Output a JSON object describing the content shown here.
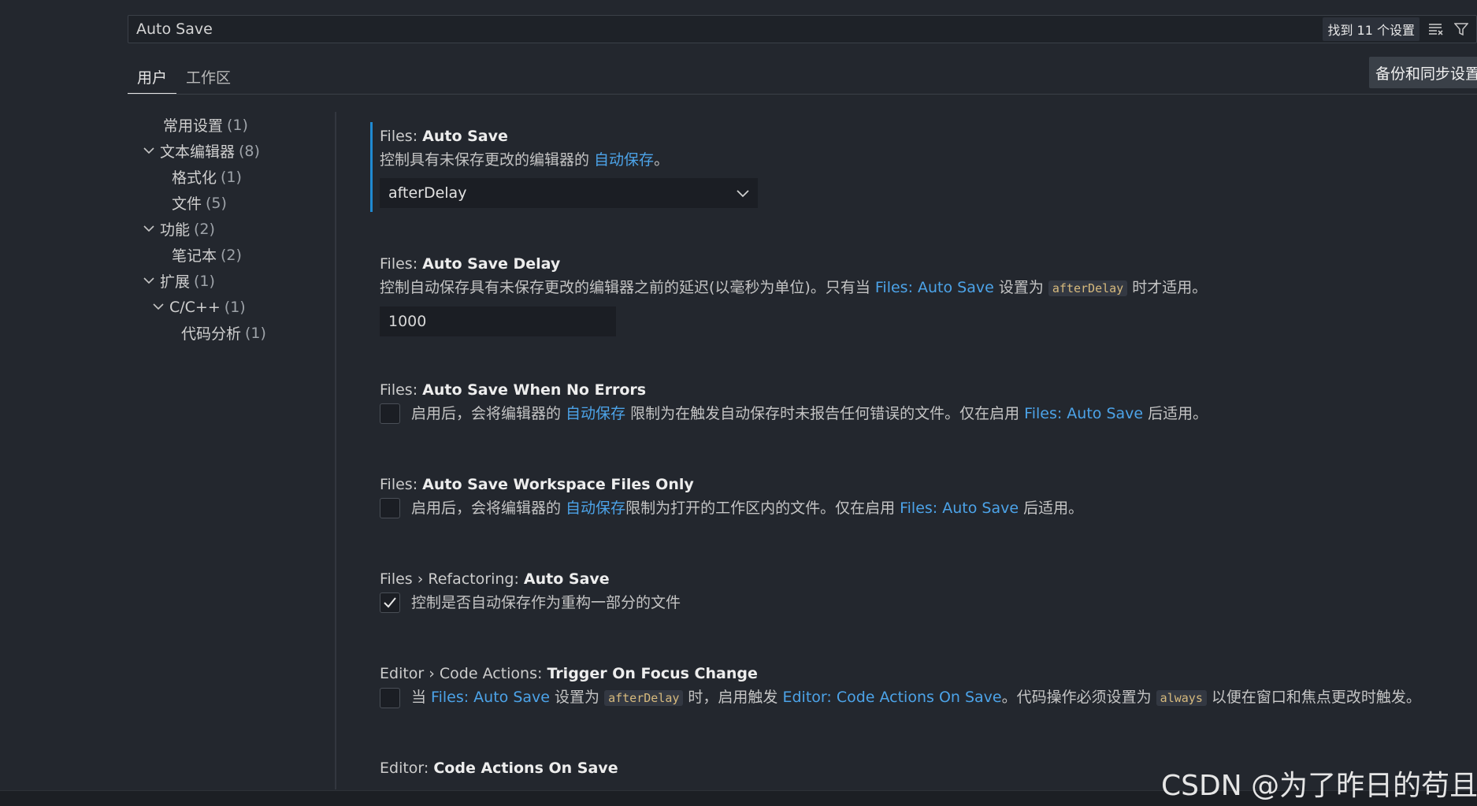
{
  "search": {
    "value": "Auto Save",
    "result_count": "找到 11 个设置"
  },
  "tabs": [
    {
      "label": "用户",
      "active": true
    },
    {
      "label": "工作区",
      "active": false
    }
  ],
  "sync_button": "备份和同步设置",
  "toc": [
    {
      "label": "常用设置",
      "count": "(1)"
    },
    {
      "label": "文本编辑器",
      "count": "(8)"
    },
    {
      "label": "格式化",
      "count": "(1)"
    },
    {
      "label": "文件",
      "count": "(5)"
    },
    {
      "label": "功能",
      "count": "(2)"
    },
    {
      "label": "笔记本",
      "count": "(2)"
    },
    {
      "label": "扩展",
      "count": "(1)"
    },
    {
      "label": "C/C++",
      "count": "(1)"
    },
    {
      "label": "代码分析",
      "count": "(1)"
    }
  ],
  "settings": {
    "auto_save": {
      "prefix": "Files: ",
      "name": "Auto Save",
      "desc_pre": "控制具有未保存更改的编辑器的 ",
      "desc_link": "自动保存",
      "desc_post": "。",
      "value": "afterDelay"
    },
    "auto_save_delay": {
      "prefix": "Files: ",
      "name": "Auto Save Delay",
      "desc_pre": "控制自动保存具有未保存更改的编辑器之前的延迟(以毫秒为单位)。只有当 ",
      "desc_link": "Files: Auto Save",
      "desc_mid": " 设置为 ",
      "desc_code": "afterDelay",
      "desc_post": " 时才适用。",
      "value": "1000"
    },
    "no_errors": {
      "prefix": "Files: ",
      "name": "Auto Save When No Errors",
      "desc_pre": "启用后，会将编辑器的 ",
      "desc_link": "自动保存",
      "desc_mid": " 限制为在触发自动保存时未报告任何错误的文件。仅在启用 ",
      "desc_link2": "Files: Auto Save",
      "desc_post": " 后适用。",
      "checked": false
    },
    "workspace_only": {
      "prefix": "Files: ",
      "name": "Auto Save Workspace Files Only",
      "desc_pre": "启用后，会将编辑器的 ",
      "desc_link": "自动保存",
      "desc_mid": "限制为打开的工作区内的文件。仅在启用 ",
      "desc_link2": "Files: Auto Save",
      "desc_post": " 后适用。",
      "checked": false
    },
    "refactoring": {
      "prefix": "Files › Refactoring: ",
      "name": "Auto Save",
      "desc": "控制是否自动保存作为重构一部分的文件",
      "checked": true
    },
    "focus_change": {
      "prefix": "Editor › Code Actions: ",
      "name": "Trigger On Focus Change",
      "desc_pre": "当 ",
      "desc_link": "Files: Auto Save",
      "desc_mid": " 设置为 ",
      "desc_code": "afterDelay",
      "desc_mid2": " 时，启用触发 ",
      "desc_link2": "Editor: Code Actions On Save",
      "desc_mid3": "。代码操作必须设置为 ",
      "desc_code2": "always",
      "desc_post": " 以便在窗口和焦点更改时触发。",
      "checked": false
    },
    "on_save": {
      "prefix": "Editor: ",
      "name": "Code Actions On Save"
    }
  },
  "watermark": "CSDN @为了昨日的苟且"
}
